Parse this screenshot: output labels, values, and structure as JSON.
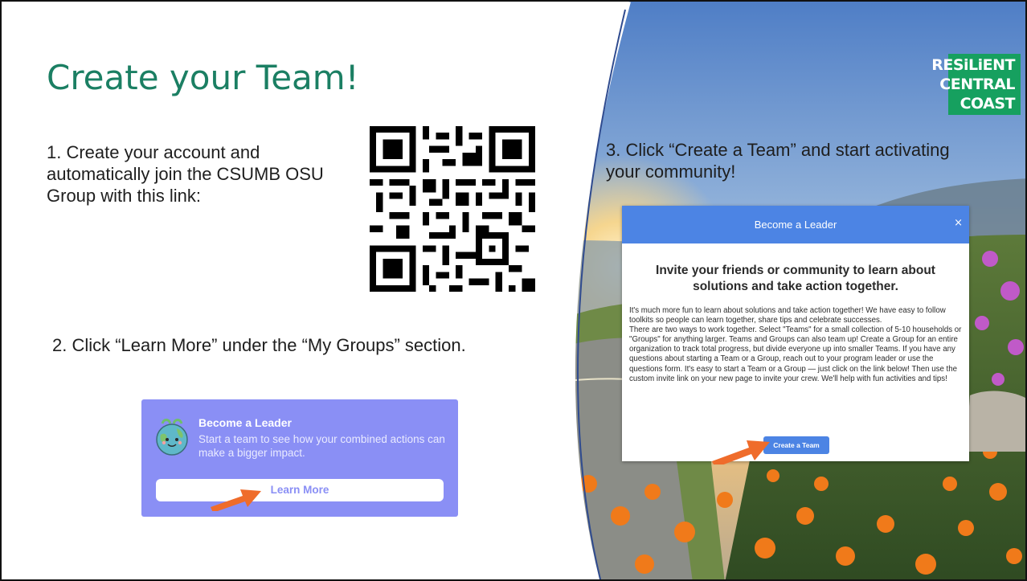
{
  "slide": {
    "title": "Create your Team!",
    "step1": "1. Create your account and automatically join the CSUMB OSU Group with this link:",
    "step2": "2. Click “Learn More” under the “My Groups” section.",
    "step3": "3. Click “Create a Team” and start activating your community!"
  },
  "logo": {
    "line1": "RESiLiENT",
    "line2": "CENTRAL",
    "line3": "COAST",
    "color": "#16a05f"
  },
  "leader_card": {
    "title": "Become a Leader",
    "description": "Start a team to see how your combined actions can make a bigger impact.",
    "button": "Learn More",
    "color": "#8a8ff5"
  },
  "modal": {
    "header": "Become a Leader",
    "close": "×",
    "heading": "Invite your friends or community to learn about solutions and take action together.",
    "paragraph1": "It's much more fun to learn about solutions and take action together! We have easy to follow toolkits so people can learn together, share tips and celebrate successes.",
    "paragraph2": "There are two ways to work together. Select \"Teams\" for a small collection of 5-10 households or \"Groups\" for anything larger. Teams and Groups can also team up! Create a Group for an entire organization to track total progress, but divide everyone up into smaller Teams. If you have any questions about starting a Team or a Group, reach out to your program leader or use the questions form. It's easy to start a Team or a Group — just click on the link below! Then use the custom invite link on your new page to invite your crew. We'll help with fun activities and tips!",
    "button": "Create a Team",
    "color": "#4c84e4"
  },
  "colors": {
    "title": "#1b7f63",
    "arrow": "#ef6c2b"
  }
}
